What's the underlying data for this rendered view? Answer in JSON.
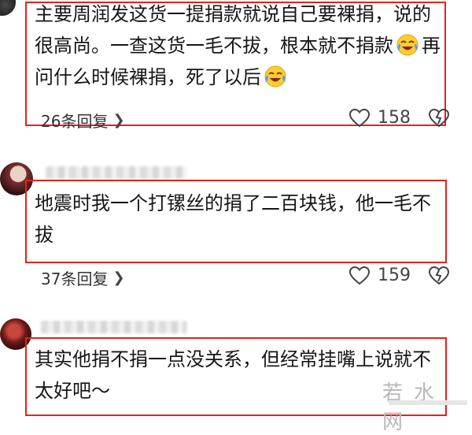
{
  "comments": [
    {
      "text_parts": [
        "主要周润发这货一提捐款就说自己要裸捐，说的很高尚。一查这货一毛不拔，根本就不捐款",
        "再问什么时候裸捐，死了以后"
      ],
      "emoji": "laugh-cry-emoji",
      "reply_label": "26条回复",
      "likes": "158"
    },
    {
      "text": "地震时我一个打镙丝的捐了二百块钱，他一毛不拔",
      "reply_label": "37条回复",
      "likes": "159"
    },
    {
      "text": "其实他捐不捐一点没关系，但经常挂嘴上说就不太好吧～"
    }
  ],
  "watermark": "若水网",
  "colors": {
    "highlight": "#e2231a",
    "text": "#161616"
  },
  "icons": [
    "heart-icon",
    "dislike-icon",
    "chevron-right-icon",
    "laugh-cry-emoji"
  ]
}
